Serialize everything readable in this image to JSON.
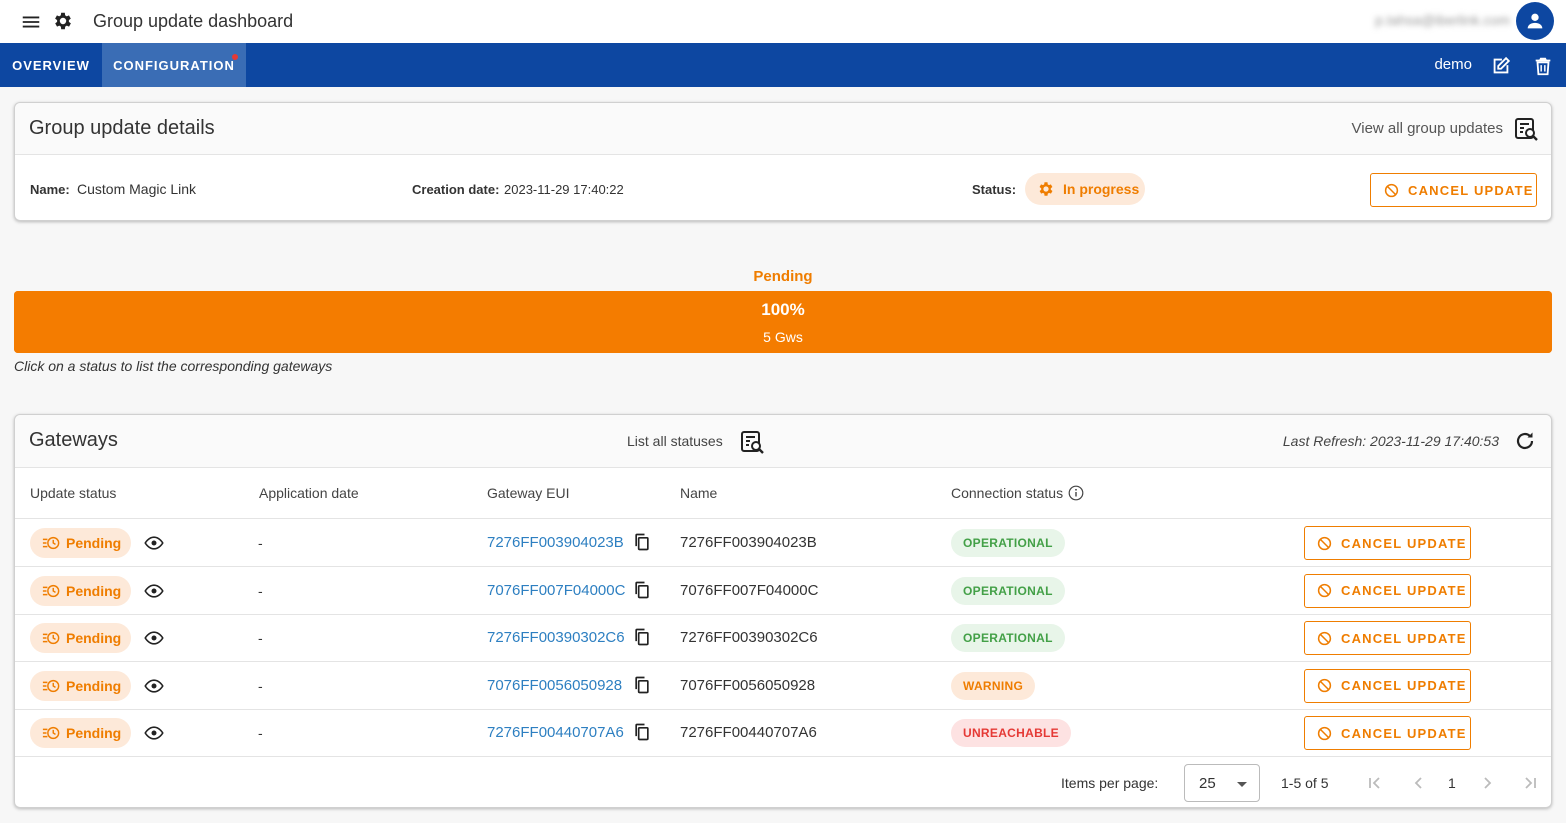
{
  "app": {
    "title": "Group update dashboard",
    "user_email": "p.tahsa@iberlink.com"
  },
  "nav": {
    "tabs": [
      {
        "label": "OVERVIEW",
        "active": false
      },
      {
        "label": "CONFIGURATION",
        "active": true,
        "has_notification_dot": true
      }
    ],
    "current_user": "demo"
  },
  "details": {
    "title": "Group update details",
    "view_all_label": "View all group updates",
    "name_label": "Name:",
    "name_value": "Custom Magic Link",
    "creation_label": "Creation date:",
    "creation_value": "2023-11-29 17:40:22",
    "status_label": "Status:",
    "status_value": "In progress",
    "cancel_label": "CANCEL UPDATE"
  },
  "progress": {
    "status": "Pending",
    "percent_label": "100%",
    "percent": 100,
    "count_label": "5 Gws",
    "hint": "Click on a status to list the corresponding gateways"
  },
  "gateways": {
    "title": "Gateways",
    "list_statuses_label": "List all statuses",
    "last_refresh": "Last Refresh: 2023-11-29 17:40:53",
    "columns": [
      "Update status",
      "Application date",
      "Gateway EUI",
      "Name",
      "Connection status"
    ],
    "rows": [
      {
        "update_status": "Pending",
        "application_date": "-",
        "eui": "7276FF003904023B",
        "name": "7276FF003904023B",
        "connection": "OPERATIONAL",
        "cancel": "CANCEL UPDATE"
      },
      {
        "update_status": "Pending",
        "application_date": "-",
        "eui": "7076FF007F04000C",
        "name": "7076FF007F04000C",
        "connection": "OPERATIONAL",
        "cancel": "CANCEL UPDATE"
      },
      {
        "update_status": "Pending",
        "application_date": "-",
        "eui": "7276FF00390302C6",
        "name": "7276FF00390302C6",
        "connection": "OPERATIONAL",
        "cancel": "CANCEL UPDATE"
      },
      {
        "update_status": "Pending",
        "application_date": "-",
        "eui": "7076FF0056050928",
        "name": "7076FF0056050928",
        "connection": "WARNING",
        "cancel": "CANCEL UPDATE"
      },
      {
        "update_status": "Pending",
        "application_date": "-",
        "eui": "7276FF00440707A6",
        "name": "7276FF00440707A6",
        "connection": "UNREACHABLE",
        "cancel": "CANCEL UPDATE"
      }
    ]
  },
  "paginator": {
    "items_per_page_label": "Items per page:",
    "items_per_page": "25",
    "range": "1-5 of 5",
    "page": "1"
  },
  "colors": {
    "brand_blue": "#0d47a1",
    "accent_orange": "#ef7d00",
    "link_blue": "#2d7fc1",
    "operational_green": "#43a047",
    "unreachable_red": "#e53935"
  },
  "icons": {
    "menu": "menu-icon",
    "settings": "gear-icon",
    "avatar": "account-icon",
    "edit": "edit-icon",
    "delete": "trash-icon",
    "view_all": "list-search-icon",
    "in_progress": "cog-spinner-icon",
    "cancel": "block-icon",
    "pending": "schedule-list-icon",
    "details": "eye-icon",
    "copy": "copy-icon",
    "info": "info-icon",
    "refresh": "refresh-icon"
  }
}
